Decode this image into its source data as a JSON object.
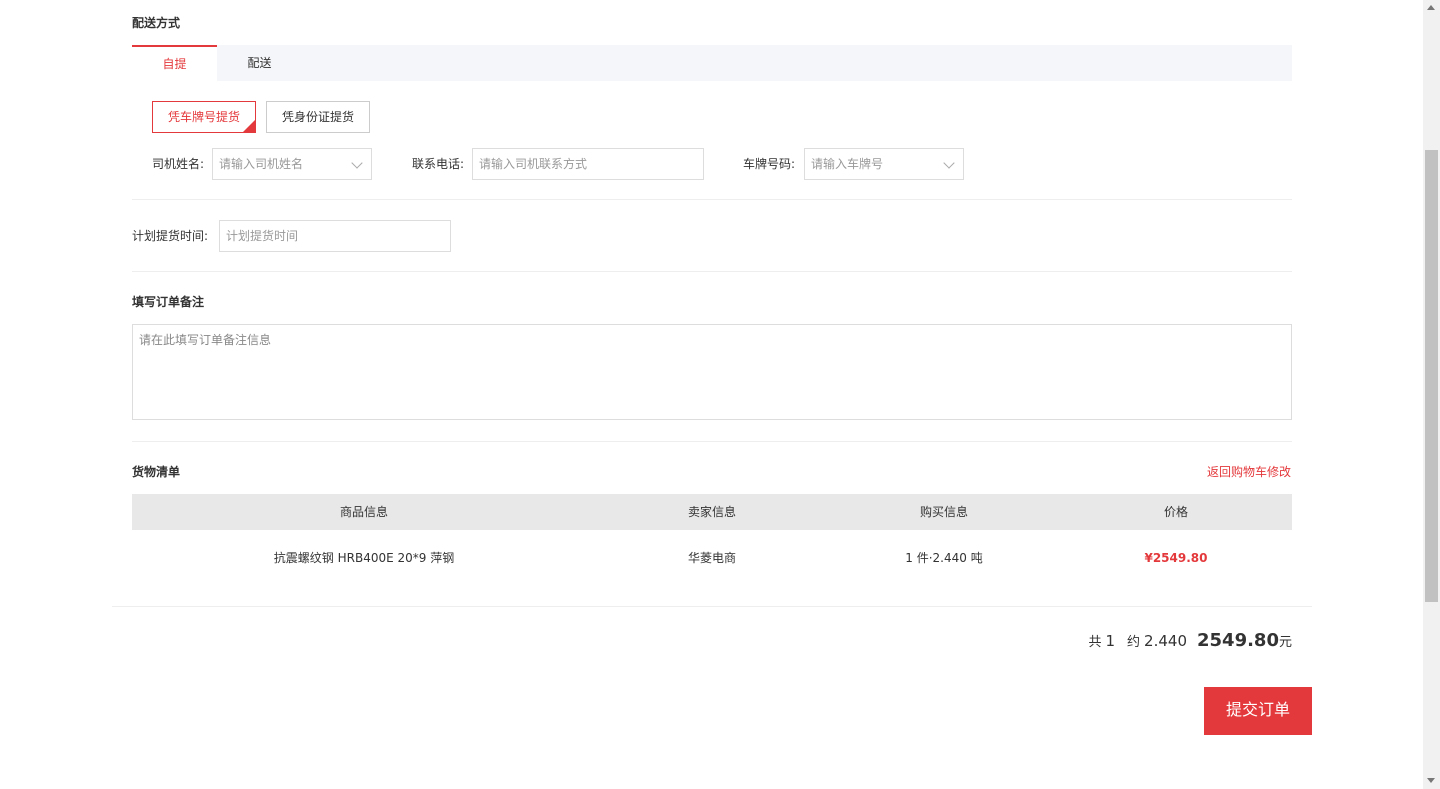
{
  "delivery": {
    "title": "配送方式",
    "tabs": [
      {
        "label": "自提",
        "active": true
      },
      {
        "label": "配送",
        "active": false
      }
    ],
    "pickup_modes": [
      {
        "label": "凭车牌号提货",
        "active": true
      },
      {
        "label": "凭身份证提货",
        "active": false
      }
    ],
    "driver_name": {
      "label": "司机姓名:",
      "placeholder": "请输入司机姓名"
    },
    "phone": {
      "label": "联系电话:",
      "placeholder": "请输入司机联系方式"
    },
    "plate": {
      "label": "车牌号码:",
      "placeholder": "请输入车牌号"
    },
    "plan_time": {
      "label": "计划提货时间:",
      "placeholder": "计划提货时间"
    }
  },
  "remark": {
    "title": "填写订单备注",
    "placeholder": "请在此填写订单备注信息"
  },
  "goods": {
    "title": "货物清单",
    "back_link": "返回购物车修改",
    "columns": [
      "商品信息",
      "卖家信息",
      "购买信息",
      "价格"
    ],
    "rows": [
      {
        "product": "抗震螺纹钢 HRB400E 20*9 萍钢",
        "seller": "华菱电商",
        "purchase": "1 件·2.440 吨",
        "price": "¥2549.80"
      }
    ]
  },
  "totals": {
    "count_prefix": "共",
    "count": "1",
    "approx_prefix": "约",
    "weight": "2.440",
    "amount": "2549.80",
    "unit": "元"
  },
  "submit_label": "提交订单",
  "colors": {
    "accent": "#e4393c",
    "tab_bg": "#f5f6f9",
    "table_head_bg": "#e8e8e8"
  }
}
